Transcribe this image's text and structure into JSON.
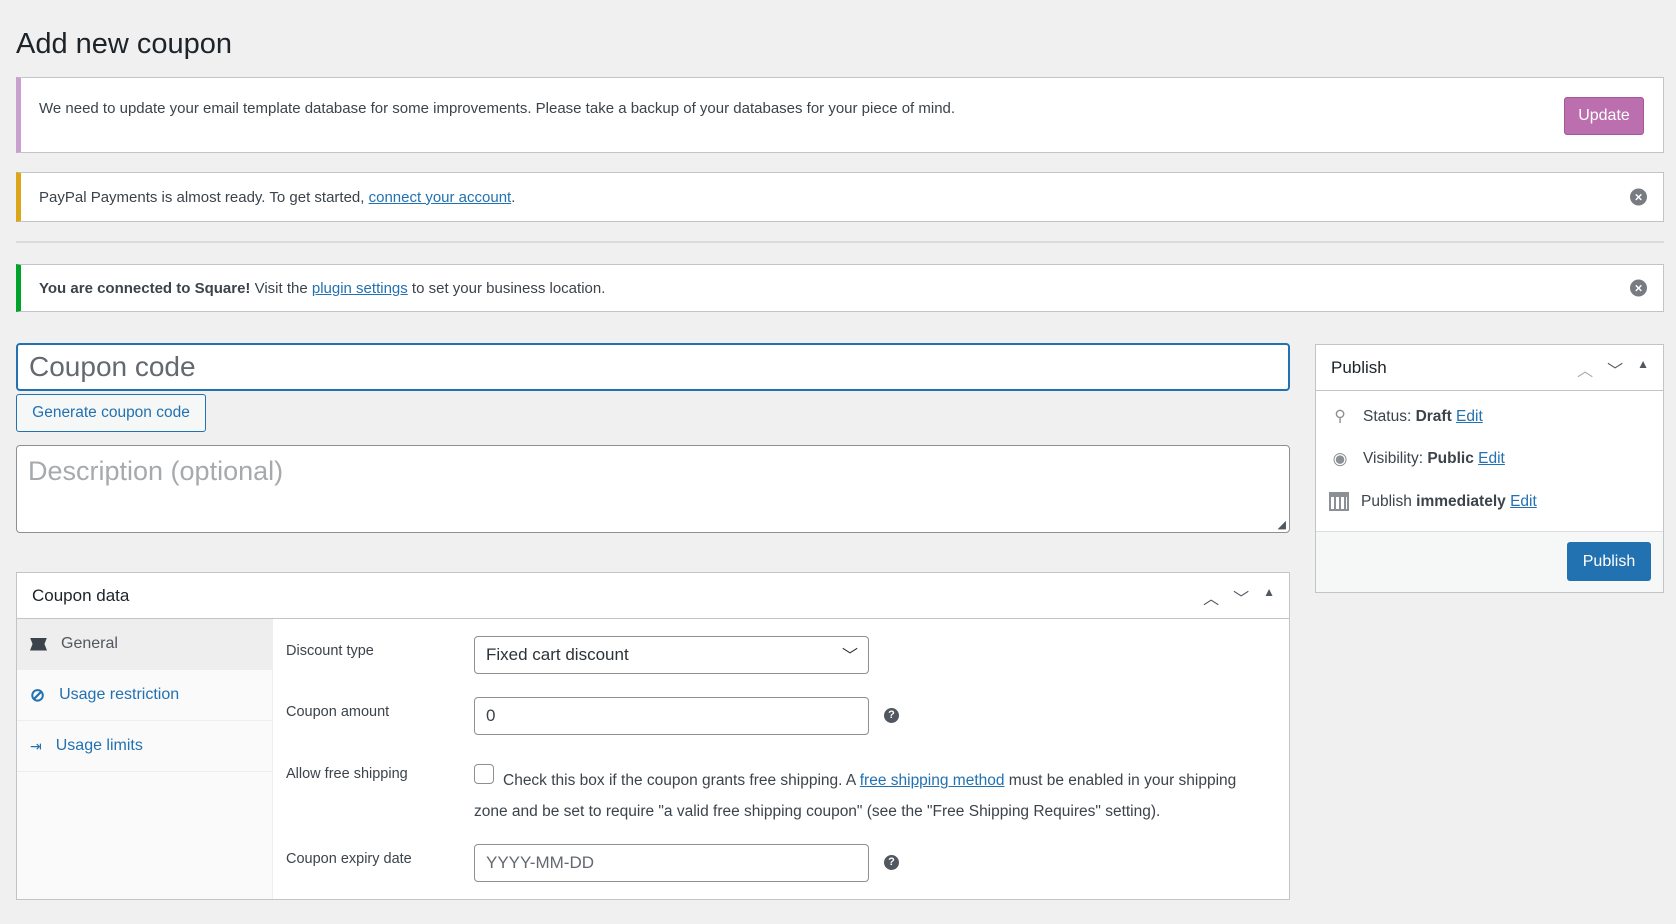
{
  "page_title": "Add new coupon",
  "notices": {
    "email": {
      "text": "We need to update your email template database for some improvements. Please take a backup of your databases for your piece of mind.",
      "button": "Update",
      "color": "#bb6fae"
    },
    "paypal": {
      "text_before": "PayPal Payments is almost ready. To get started, ",
      "link": "connect your account",
      "text_after": ".",
      "color": "#dba617"
    },
    "square": {
      "bold": "You are connected to Square!",
      "text_before": " Visit the ",
      "link": "plugin settings",
      "text_after": " to set your business location.",
      "color": "#00a32a"
    }
  },
  "coupon_code": {
    "placeholder": "Coupon code",
    "value": ""
  },
  "generate_button": "Generate coupon code",
  "description": {
    "placeholder": "Description (optional)",
    "value": ""
  },
  "coupon_data": {
    "title": "Coupon data",
    "tabs": [
      {
        "label": "General",
        "icon": "ticket-icon",
        "active": true
      },
      {
        "label": "Usage restriction",
        "icon": "ban-icon"
      },
      {
        "label": "Usage limits",
        "icon": "arrows-in-icon"
      }
    ],
    "fields": {
      "discount_type": {
        "label": "Discount type",
        "value": "Fixed cart discount"
      },
      "coupon_amount": {
        "label": "Coupon amount",
        "value": "0"
      },
      "free_shipping": {
        "label": "Allow free shipping",
        "checked": false,
        "text_before": "Check this box if the coupon grants free shipping. A ",
        "link": "free shipping method",
        "text_after": " must be enabled in your shipping zone and be set to require \"a valid free shipping coupon\" (see the \"Free Shipping Requires\" setting)."
      },
      "expiry_date": {
        "label": "Coupon expiry date",
        "placeholder": "YYYY-MM-DD",
        "value": ""
      }
    }
  },
  "publish": {
    "title": "Publish",
    "status_label": "Status:",
    "status_value": "Draft",
    "visibility_label": "Visibility:",
    "visibility_value": "Public",
    "schedule_label": "Publish",
    "schedule_value": "immediately",
    "edit": "Edit",
    "button": "Publish",
    "accent": "#2271b1"
  }
}
